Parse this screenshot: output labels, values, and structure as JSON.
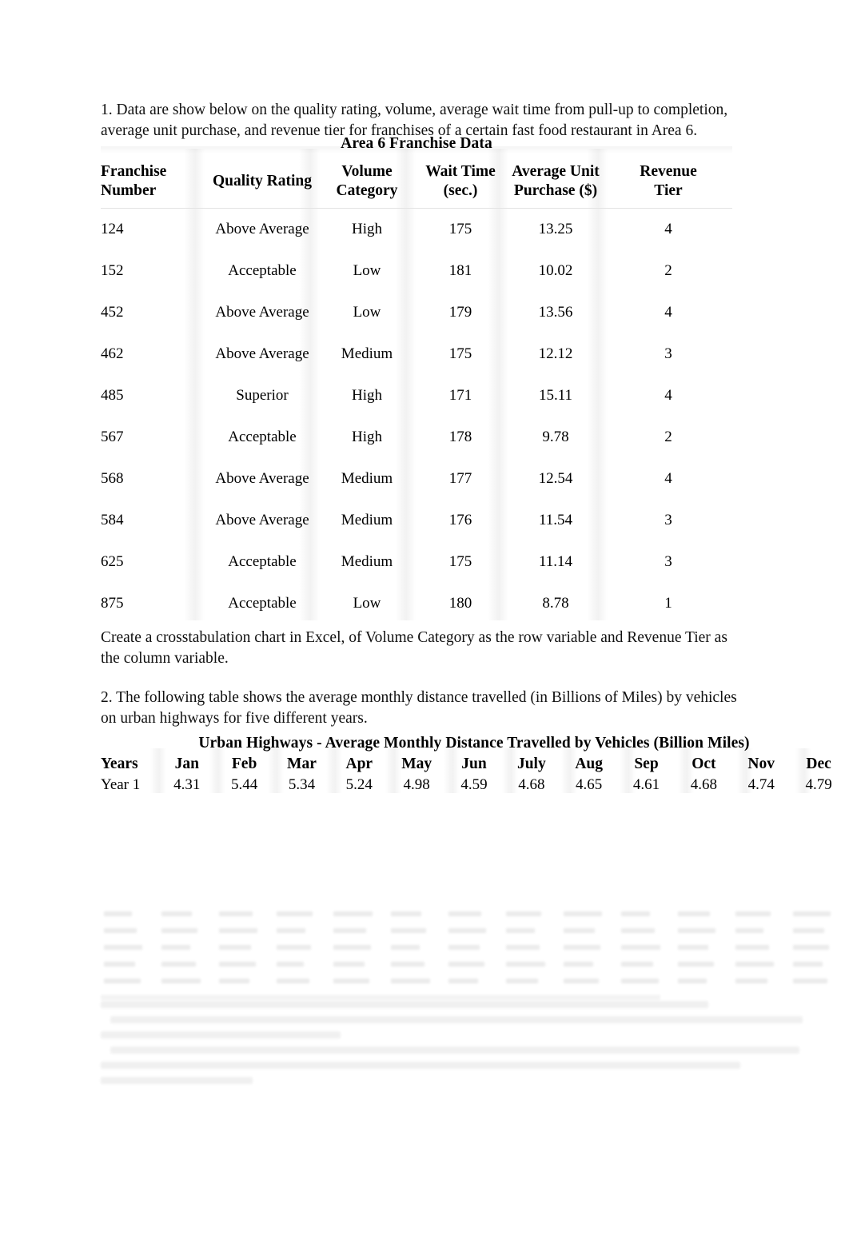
{
  "document": {
    "background_color": "#ffffff",
    "text_color": "#000000"
  },
  "question1": {
    "intro": "1. Data are show below on the quality rating, volume, average wait time from pull-up to completion, average unit purchase, and revenue tier for franchises of a certain fast food restaurant in Area 6.",
    "table": {
      "title": "Area 6 Franchise Data",
      "columns": [
        "Franchise Number",
        "Quality Rating",
        "Volume Category",
        "Wait Time (sec.)",
        "Average Unit Purchase ($)",
        "Revenue Tier"
      ],
      "column_lines": [
        [
          "Franchise",
          "Number"
        ],
        [
          "Quality Rating"
        ],
        [
          "Volume",
          "Category"
        ],
        [
          "Wait Time",
          "(sec.)"
        ],
        [
          "Average Unit",
          "Purchase ($)"
        ],
        [
          "Revenue",
          "Tier"
        ]
      ],
      "rows": [
        [
          "124",
          "Above Average",
          "High",
          "175",
          "13.25",
          "4"
        ],
        [
          "152",
          "Acceptable",
          "Low",
          "181",
          "10.02",
          "2"
        ],
        [
          "452",
          "Above Average",
          "Low",
          "179",
          "13.56",
          "4"
        ],
        [
          "462",
          "Above Average",
          "Medium",
          "175",
          "12.12",
          "3"
        ],
        [
          "485",
          "Superior",
          "High",
          "171",
          "15.11",
          "4"
        ],
        [
          "567",
          "Acceptable",
          "High",
          "178",
          "9.78",
          "2"
        ],
        [
          "568",
          "Above Average",
          "Medium",
          "177",
          "12.54",
          "4"
        ],
        [
          "584",
          "Above Average",
          "Medium",
          "176",
          "11.54",
          "3"
        ],
        [
          "625",
          "Acceptable",
          "Medium",
          "175",
          "11.14",
          "3"
        ],
        [
          "875",
          "Acceptable",
          "Low",
          "180",
          "8.78",
          "1"
        ]
      ]
    },
    "task": "Create a crosstabulation chart in Excel, of Volume Category as the row variable and Revenue Tier as the column variable."
  },
  "question2": {
    "intro": "2. The following table shows the average monthly distance travelled (in Billions of Miles) by vehicles on urban highways for five different years.",
    "table": {
      "title": "Urban Highways - Average Monthly Distance Travelled by Vehicles (Billion Miles)",
      "columns": [
        "Years",
        "Jan",
        "Feb",
        "Mar",
        "Apr",
        "May",
        "Jun",
        "July",
        "Aug",
        "Sep",
        "Oct",
        "Nov",
        "Dec"
      ],
      "rows": [
        [
          "Year 1",
          "4.31",
          "5.44",
          "5.34",
          "5.24",
          "4.98",
          "4.59",
          "4.68",
          "4.65",
          "4.61",
          "4.68",
          "4.74",
          "4.79"
        ]
      ]
    }
  },
  "faded_artifacts": {
    "note": "illegible ghosted content at bottom of page",
    "ghost_table_columns": 13,
    "ghost_table_rows": 5,
    "ghost_paragraph_lines": 6
  }
}
